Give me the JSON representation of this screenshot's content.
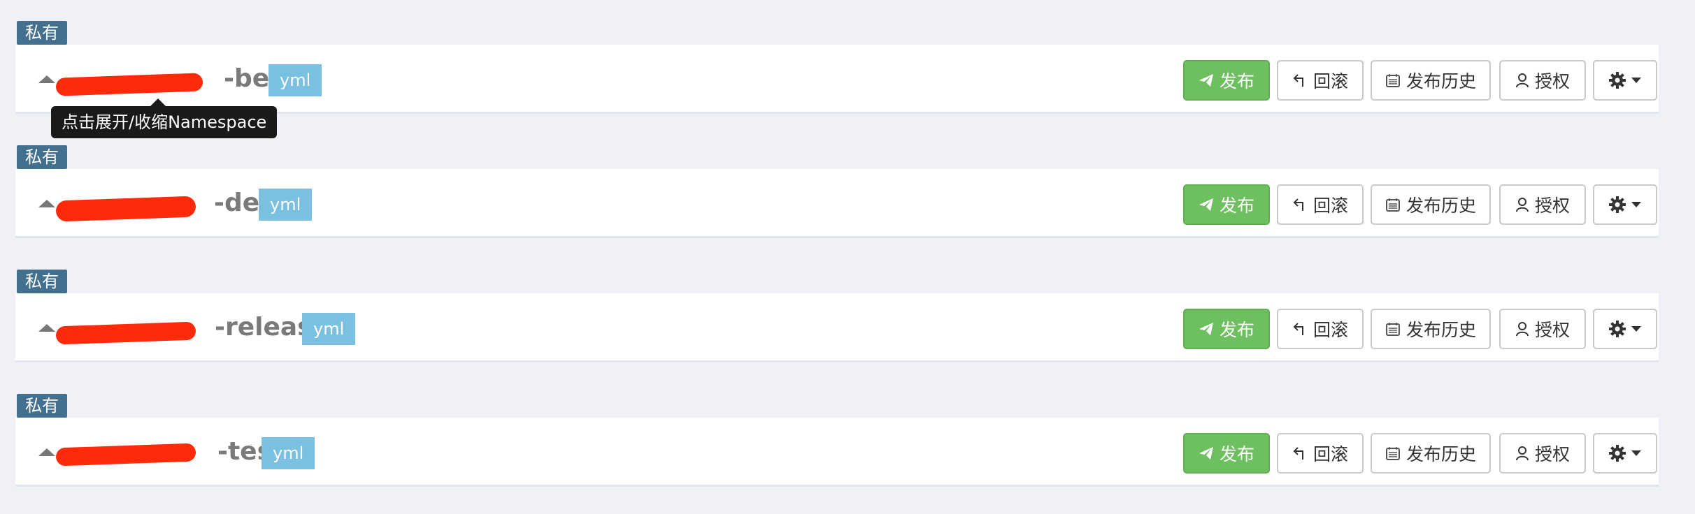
{
  "namespaces": [
    {
      "scope_badge": "私有",
      "name": "-beta",
      "format": "yml",
      "buttons": {
        "publish": "发布",
        "rollback": "回滚",
        "history": "发布历史",
        "grant": "授权"
      }
    },
    {
      "scope_badge": "私有",
      "name": "-dev",
      "format": "yml",
      "buttons": {
        "publish": "发布",
        "rollback": "回滚",
        "history": "发布历史",
        "grant": "授权"
      }
    },
    {
      "scope_badge": "私有",
      "name": "-release",
      "format": "yml",
      "buttons": {
        "publish": "发布",
        "rollback": "回滚",
        "history": "发布历史",
        "grant": "授权"
      }
    },
    {
      "scope_badge": "私有",
      "name": "-test",
      "format": "yml",
      "buttons": {
        "publish": "发布",
        "rollback": "回滚",
        "history": "发布历史",
        "grant": "授权"
      }
    }
  ],
  "tooltip": {
    "text": "点击展开/收缩Namespace"
  },
  "colors": {
    "publish": "#6ebf60",
    "scope_badge": "#43708f",
    "format_badge": "#7ac0e0",
    "redaction": "#ff2a0a"
  },
  "icons": {
    "collapse": "triangle-up-icon",
    "publish": "paper-plane-icon",
    "rollback": "undo-arrow-icon",
    "history": "calendar-icon",
    "grant": "user-icon",
    "settings": "gear-icon"
  }
}
